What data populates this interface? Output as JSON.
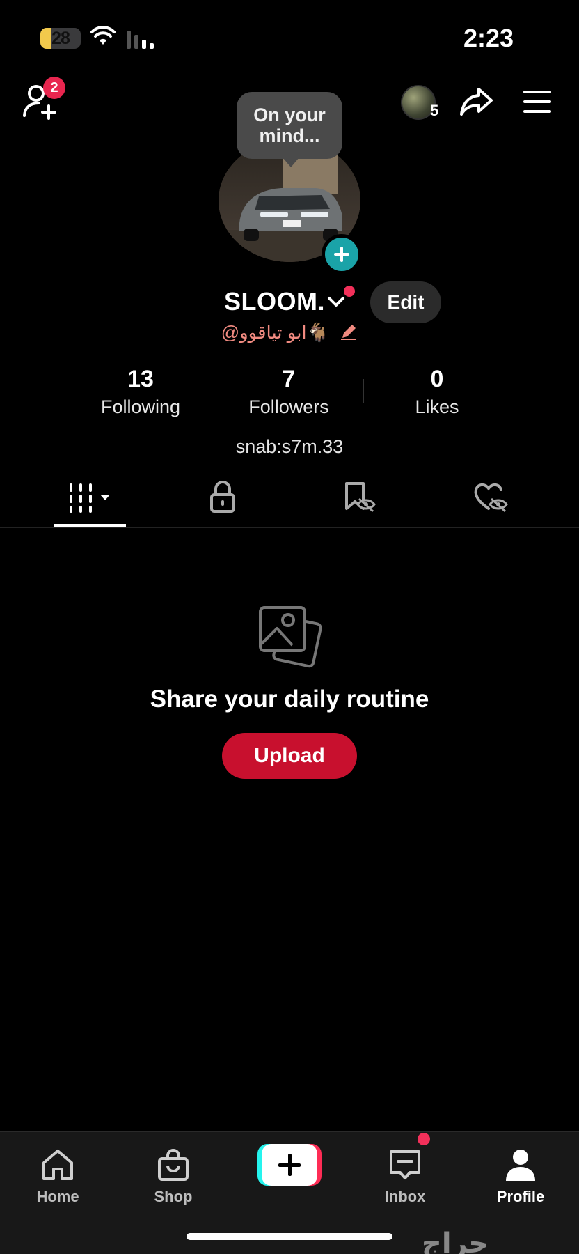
{
  "status_bar": {
    "battery": "28",
    "time": "2:23"
  },
  "top_bar": {
    "friend_requests_count": "2",
    "accounts_count": "5"
  },
  "tooltip": {
    "text": "On your mind..."
  },
  "profile": {
    "username": "SLOOM.",
    "handle": "@ابو تياقوو🐐",
    "edit_label": "Edit",
    "bio": "snab:s7m.33"
  },
  "stats": [
    {
      "value": "13",
      "label": "Following"
    },
    {
      "value": "7",
      "label": "Followers"
    },
    {
      "value": "0",
      "label": "Likes"
    }
  ],
  "empty_state": {
    "title": "Share your daily routine",
    "button": "Upload"
  },
  "nav": {
    "home": "Home",
    "shop": "Shop",
    "inbox": "Inbox",
    "profile": "Profile"
  },
  "watermark": "حراج",
  "colors": {
    "accent": "#c8102e",
    "badge": "#e8264f",
    "teal": "#1aa3a8",
    "handle": "#f08a80"
  }
}
